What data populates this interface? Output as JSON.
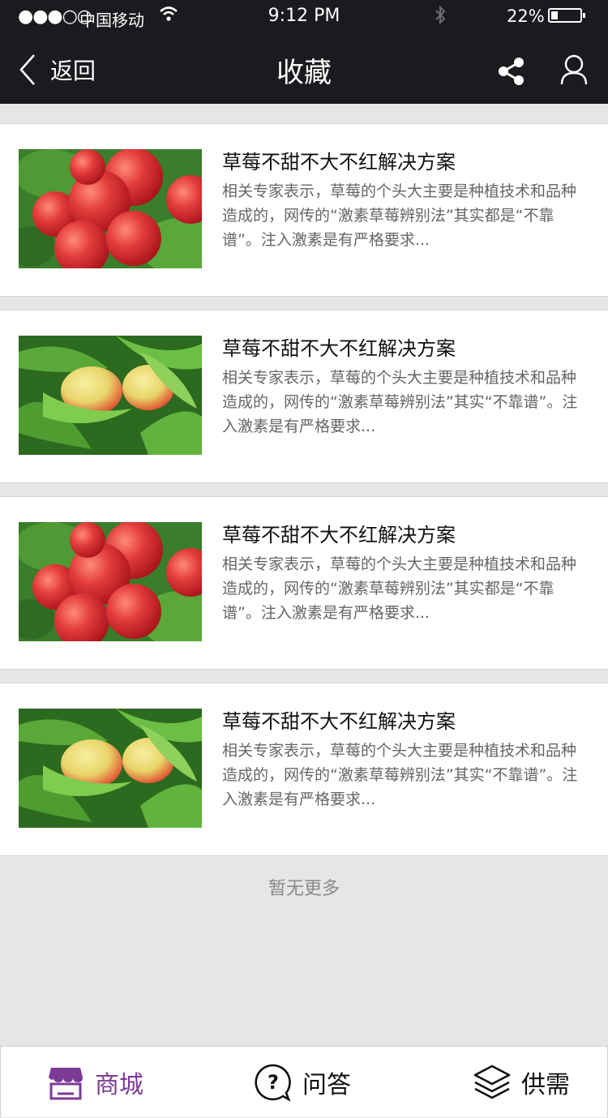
{
  "status_bar": {
    "signal": "●●●○○",
    "carrier": "中国移动",
    "time": "9:12 PM",
    "battery_percent": "22%"
  },
  "nav": {
    "back_label": "返回",
    "title": "收藏"
  },
  "items": [
    {
      "title": "草莓不甜不大不红解决方案",
      "description": "相关专家表示，草莓的个头大主要是种植技术和品种造成的，网传的“激素草莓辨别法”其实都是“不靠谱”。注入激素是有严格要求...",
      "image": "red-apples"
    },
    {
      "title": "草莓不甜不大不红解决方案",
      "description": "相关专家表示，草莓的个头大主要是种植技术和品种造成的，网传的“激素草莓辨别法”其实“不靠谱”。注入激素是有严格要求...",
      "image": "peaches-leaves"
    },
    {
      "title": "草莓不甜不大不红解决方案",
      "description": "相关专家表示，草莓的个头大主要是种植技术和品种造成的，网传的“激素草莓辨别法”其实都是“不靠谱”。注入激素是有严格要求...",
      "image": "red-apples"
    },
    {
      "title": "草莓不甜不大不红解决方案",
      "description": "相关专家表示，草莓的个头大主要是种植技术和品种造成的，网传的“激素草莓辨别法”其实“不靠谱”。注入激素是有严格要求...",
      "image": "peaches-leaves"
    }
  ],
  "no_more_text": "暂无更多",
  "tabs": [
    {
      "label": "商城",
      "icon": "store-icon",
      "active": true
    },
    {
      "label": "问答",
      "icon": "question-bubble-icon",
      "active": false
    },
    {
      "label": "供需",
      "icon": "layers-icon",
      "active": false
    }
  ],
  "colors": {
    "header_bg": "#1c1a1f",
    "active_tab": "#7b3a96",
    "page_bg": "#e6e6e6"
  }
}
